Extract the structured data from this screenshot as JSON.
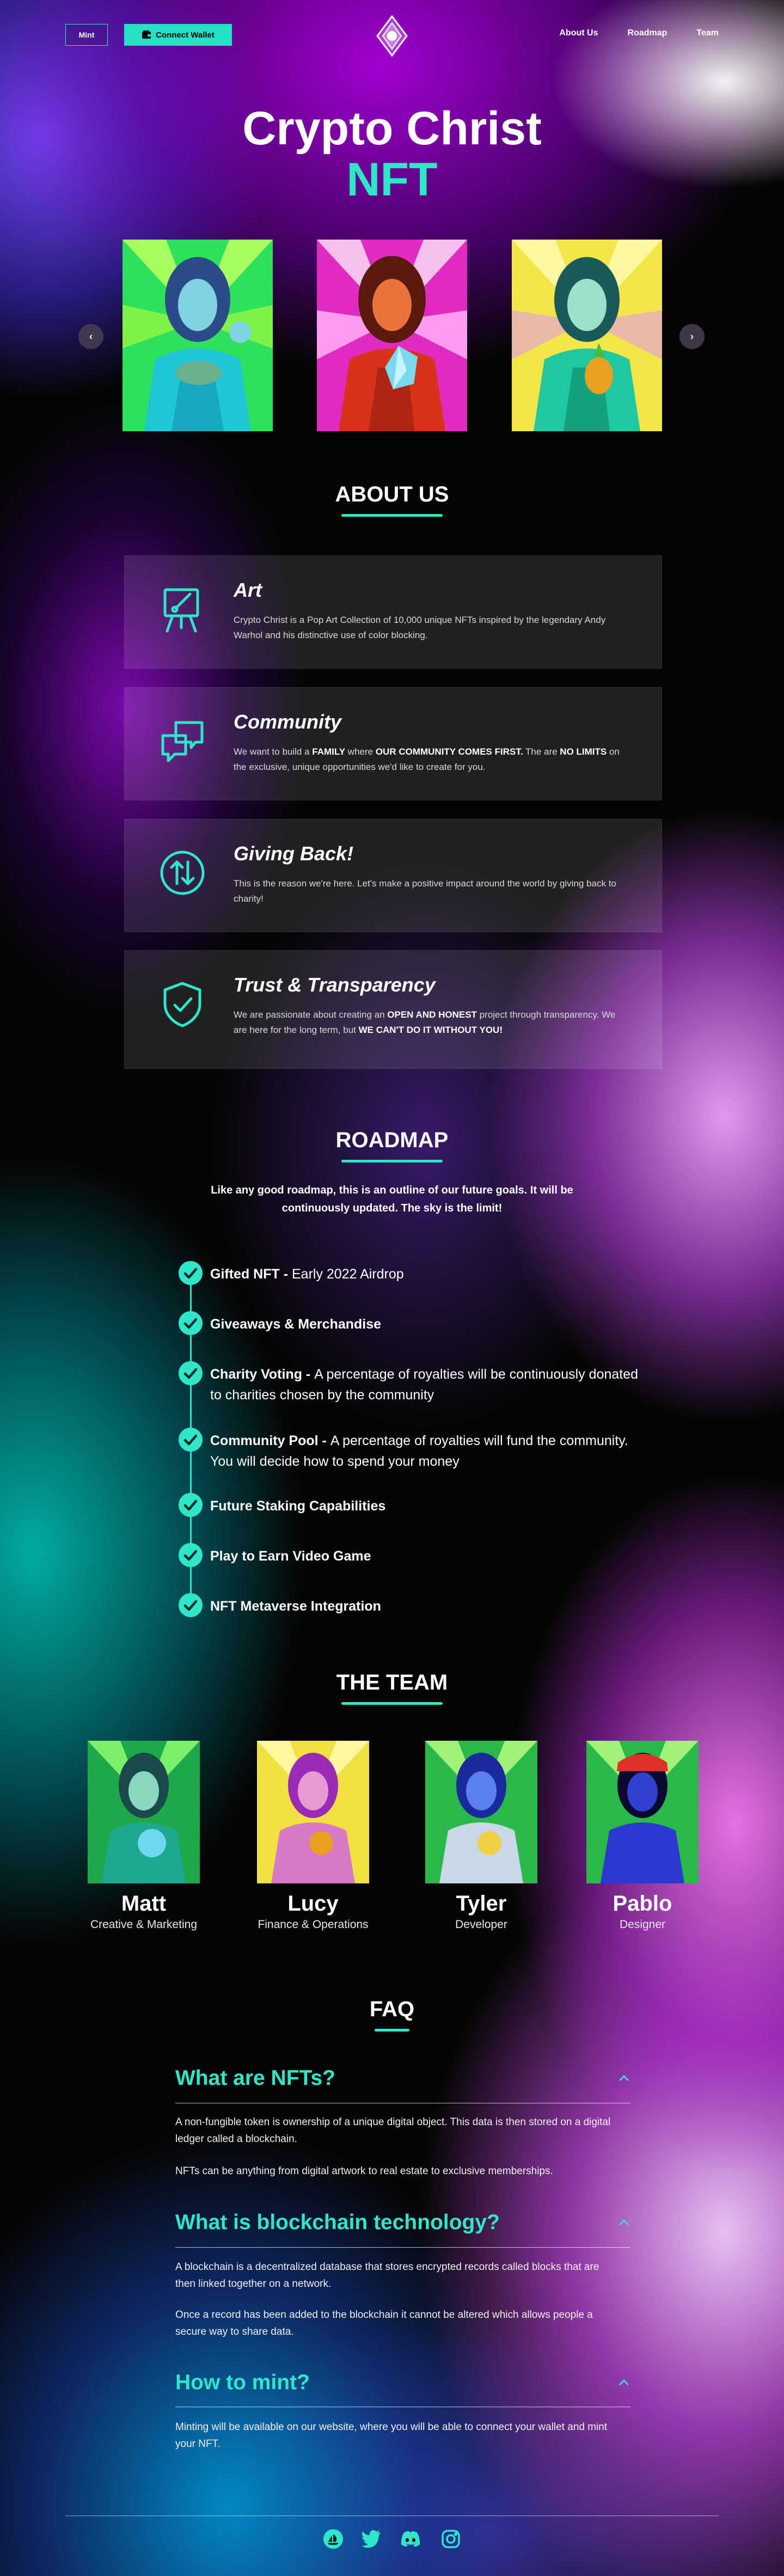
{
  "nav": {
    "mint_label": "Mint",
    "wallet_label": "Connect Wallet",
    "links": [
      "About Us",
      "Roadmap",
      "Team"
    ]
  },
  "hero": {
    "title": "Crypto Christ",
    "subtitle": "NFT",
    "prev_icon": "chevron-left-icon",
    "next_icon": "chevron-right-icon"
  },
  "about": {
    "title": "ABOUT US",
    "cards": [
      {
        "icon": "easel-icon",
        "title": "Art",
        "text": "Crypto Christ is a Pop Art Collection of 10,000 unique NFTs inspired by the legendary Andy Warhol and his distinctive use of color blocking."
      },
      {
        "icon": "chat-bubbles-icon",
        "title": "Community",
        "text_parts": [
          "We want to build a ",
          "FAMILY",
          " where ",
          "OUR COMMUNITY COMES FIRST.",
          " The are ",
          "NO LIMITS",
          " on the exclusive, unique opportunities we'd like to create for you."
        ]
      },
      {
        "icon": "exchange-arrows-icon",
        "title": "Giving Back!",
        "text": "This is the reason we're here. Let's make a positive impact around the world by giving back to charity!"
      },
      {
        "icon": "shield-check-icon",
        "title": "Trust & Transparency",
        "text_parts": [
          "We are passionate about creating an ",
          "OPEN AND HONEST",
          " project through transparency. We are here for the long term, but ",
          "WE CAN'T DO IT WITHOUT YOU!"
        ]
      }
    ]
  },
  "roadmap": {
    "title": "ROADMAP",
    "intro": "Like any good roadmap, this is an outline of our future goals. It will be continuously updated. The sky is the limit!",
    "items": [
      {
        "bold": "Gifted NFT - ",
        "text": "Early 2022 Airdrop"
      },
      {
        "bold": "Giveaways & Merchandise",
        "text": ""
      },
      {
        "bold": "Charity Voting - ",
        "text": "A percentage of royalties will be continuously donated to charities chosen by the community"
      },
      {
        "bold": "Community Pool - ",
        "text": "A percentage of royalties will fund the community. You will decide how to spend your money"
      },
      {
        "bold": "Future Staking Capabilities",
        "text": ""
      },
      {
        "bold": "Play to Earn Video Game",
        "text": ""
      },
      {
        "bold": "NFT Metaverse Integration",
        "text": ""
      }
    ]
  },
  "team": {
    "title": "THE TEAM",
    "members": [
      {
        "name": "Matt",
        "role": "Creative & Marketing"
      },
      {
        "name": "Lucy",
        "role": "Finance & Operations"
      },
      {
        "name": "Tyler",
        "role": "Developer"
      },
      {
        "name": "Pablo",
        "role": "Designer"
      }
    ]
  },
  "faq": {
    "title": "FAQ",
    "items": [
      {
        "q": "What are NFTs?",
        "a": [
          "A non-fungible token is ownership of a unique digital object. This data is then stored on a digital ledger called a blockchain.",
          "NFTs can be anything from digital artwork to real estate to exclusive memberships."
        ]
      },
      {
        "q": "What is blockchain technology?",
        "a": [
          "A blockchain is a decentralized database that stores encrypted records called blocks that are then linked together on a network.",
          "Once a record has been added to the blockchain it cannot be altered which allows people a secure way to share data."
        ]
      },
      {
        "q": "How to mint?",
        "a": [
          "Minting will be available on our website, where you will be able to connect your wallet and mint your NFT."
        ]
      }
    ]
  },
  "footer": {
    "socials": [
      "opensea-icon",
      "twitter-icon",
      "discord-icon",
      "instagram-icon"
    ]
  },
  "colors": {
    "accent": "#2de7c8",
    "card_bg": "rgba(255,255,255,0.11)"
  }
}
